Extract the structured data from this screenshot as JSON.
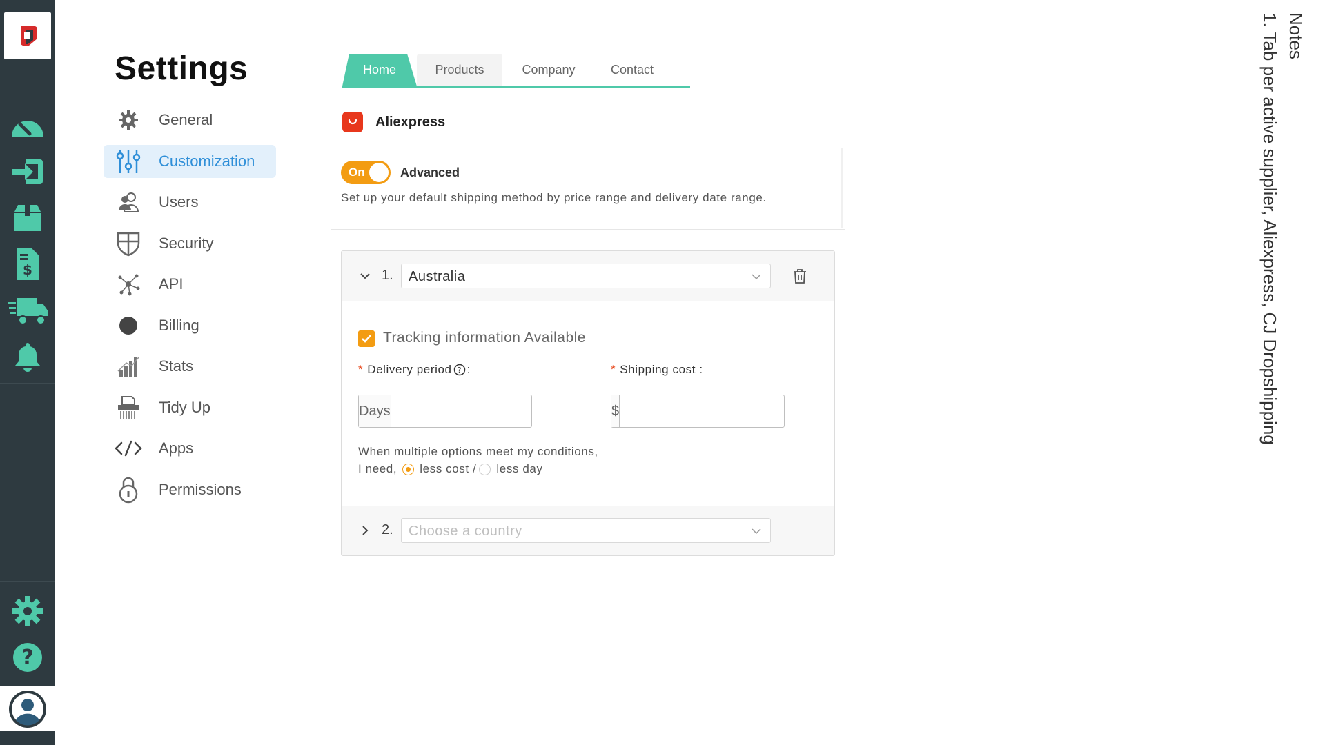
{
  "page": {
    "title": "Settings"
  },
  "nav": {
    "items": [
      {
        "label": "General",
        "icon": "gear-icon"
      },
      {
        "label": "Customization",
        "icon": "sliders-icon",
        "active": true
      },
      {
        "label": "Users",
        "icon": "users-icon"
      },
      {
        "label": "Security",
        "icon": "shield-icon"
      },
      {
        "label": "API",
        "icon": "api-network-icon"
      },
      {
        "label": "Billing",
        "icon": "billing-circle-icon"
      },
      {
        "label": "Stats",
        "icon": "stats-bars-icon"
      },
      {
        "label": "Tidy Up",
        "icon": "shredder-icon"
      },
      {
        "label": "Apps",
        "icon": "code-icon"
      },
      {
        "label": "Permissions",
        "icon": "lock-icon"
      }
    ]
  },
  "tabs": [
    {
      "label": "Home",
      "active": true
    },
    {
      "label": "Products"
    },
    {
      "label": "Company"
    },
    {
      "label": "Contact"
    }
  ],
  "supplier": {
    "name": "Aliexpress"
  },
  "shipping": {
    "toggle_label": "On",
    "advanced_label": "Advanced",
    "description": "Set up your default shipping method by price range and delivery date range.",
    "rules": [
      {
        "number": "1.",
        "country": "Australia",
        "expanded": true
      },
      {
        "number": "2.",
        "country_placeholder": "Choose a country",
        "expanded": false
      }
    ],
    "tracking_label": "Tracking information Available",
    "delivery_label": "Delivery period",
    "delivery_colon": ":",
    "shipping_cost_label": "Shipping cost :",
    "days_addon": "Days",
    "currency_addon": "$",
    "condition_line1": "When multiple options meet my conditions,",
    "condition_prefix": "I need,",
    "option_less_cost": "less cost /",
    "option_less_day": "less day",
    "required_mark": "*"
  },
  "notes": {
    "title": "Notes",
    "line1": "1. Tab per active supplier, Aliexpress, CJ Dropshipping"
  },
  "colors": {
    "rail_bg": "#2e3a40",
    "rail_icon": "#4fc9a9",
    "tab_active": "#4fc9a9",
    "accent_orange": "#f39c12",
    "nav_active_bg": "#e3f0fb",
    "nav_active_text": "#2f8fd8"
  }
}
